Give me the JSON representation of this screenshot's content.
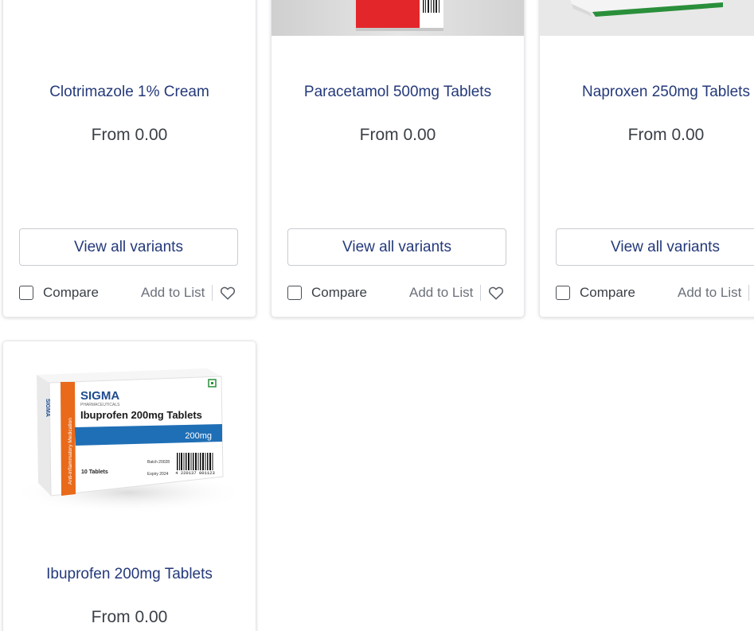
{
  "products": [
    {
      "name": "Clotrimazole 1% Cream",
      "price_label": "From 0.00",
      "variants_label": "View all variants",
      "compare_label": "Compare",
      "add_to_list_label": "Add to List",
      "image_icon": "cream-tube-image"
    },
    {
      "name": "Paracetamol 500mg Tablets",
      "price_label": "From 0.00",
      "variants_label": "View all variants",
      "compare_label": "Compare",
      "add_to_list_label": "Add to List",
      "image_icon": "red-medicine-box-image"
    },
    {
      "name": "Naproxen 250mg Tablets",
      "price_label": "From 0.00",
      "variants_label": "View all variants",
      "compare_label": "Compare",
      "add_to_list_label": "Add to List",
      "image_icon": "green-medicine-box-image"
    },
    {
      "name": "Ibuprofen 200mg Tablets",
      "price_label": "From 0.00",
      "variants_label": "View all variants",
      "compare_label": "Compare",
      "add_to_list_label": "Add to List",
      "image_icon": "ibuprofen-box-image",
      "box_text": {
        "brand": "SIGMA",
        "brand_sub": "PHARMACEUTICALS",
        "product": "Ibuprofen 200mg Tablets",
        "strength": "200mg",
        "count": "10 Tablets",
        "side": "Anti-inflammatory Medication",
        "side_brand": "SIGMA",
        "batch": "Batch 20028",
        "expiry": "Expiry 2024",
        "barcode_digits": "4 220137 001123"
      }
    }
  ],
  "colors": {
    "title": "#24397a",
    "price": "#3b4047",
    "muted": "#6c717a",
    "card_border": "#e6e7eb",
    "accent_blue": "#1f6fb6",
    "accent_orange": "#e86a1a",
    "accent_red": "#e3262a",
    "accent_green": "#2a8f3a"
  }
}
